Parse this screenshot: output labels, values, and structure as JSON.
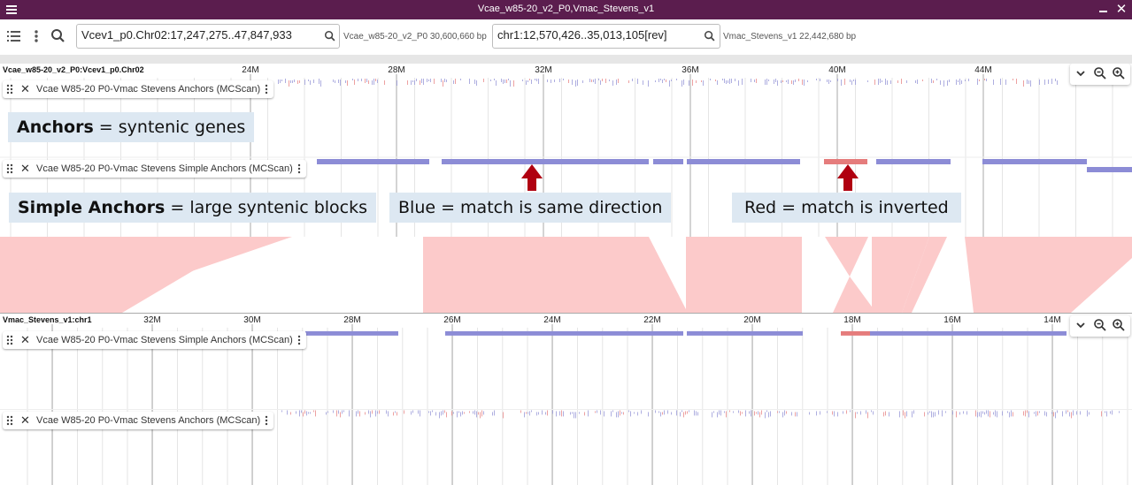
{
  "window": {
    "title": "Vcae_w85-20_v2_P0,Vmac_Stevens_v1"
  },
  "toolbar": {
    "top_location": "Vcev1_p0.Chr02:17,247,275..47,847,933",
    "top_assembly": "Vcae_w85-20_v2_P0 30,600,660 bp",
    "bottom_location": "chr1:12,570,426..35,013,105[rev]",
    "bottom_assembly": "Vmac_Stevens_v1 22,442,680 bp"
  },
  "top_view": {
    "name": "Vcae_w85-20_v2_P0:Vcev1_p0.Chr02",
    "ticks": [
      "24M",
      "28M",
      "32M",
      "36M",
      "40M",
      "44M"
    ],
    "tracks": [
      "Vcae W85-20 P0-Vmac Stevens Anchors (MCScan)",
      "Vcae W85-20 P0-Vmac Stevens Simple Anchors (MCScan)"
    ]
  },
  "bottom_view": {
    "name": "Vmac_Stevens_v1:chr1",
    "ticks": [
      "32M",
      "30M",
      "28M",
      "26M",
      "24M",
      "22M",
      "20M",
      "18M",
      "16M",
      "14M"
    ],
    "tracks": [
      "Vcae W85-20 P0-Vmac Stevens Simple Anchors (MCScan)",
      "Vcae W85-20 P0-Vmac Stevens Anchors (MCScan)"
    ]
  },
  "annotations": {
    "anchors_bold": "Anchors",
    "anchors_rest": " = syntenic genes",
    "simple_bold": "Simple Anchors",
    "simple_rest": " = large syntenic blocks",
    "blue": "Blue = match is same direction",
    "red": "Red = match is inverted"
  },
  "colors": {
    "titlebar": "#5b1d4e",
    "forward": "#8c8cd6",
    "inverted": "#e57c7c",
    "synteny": "#fccaca",
    "annotation_bg": "#dde8f2",
    "arrow": "#b00010"
  },
  "icons": [
    "menu-icon",
    "minimize-icon",
    "close-icon",
    "track-selector-icon",
    "kebab-icon",
    "search-icon",
    "chevron-down-icon",
    "zoom-out-icon",
    "zoom-in-icon",
    "drag-handle-icon",
    "arrow-up-icon"
  ]
}
